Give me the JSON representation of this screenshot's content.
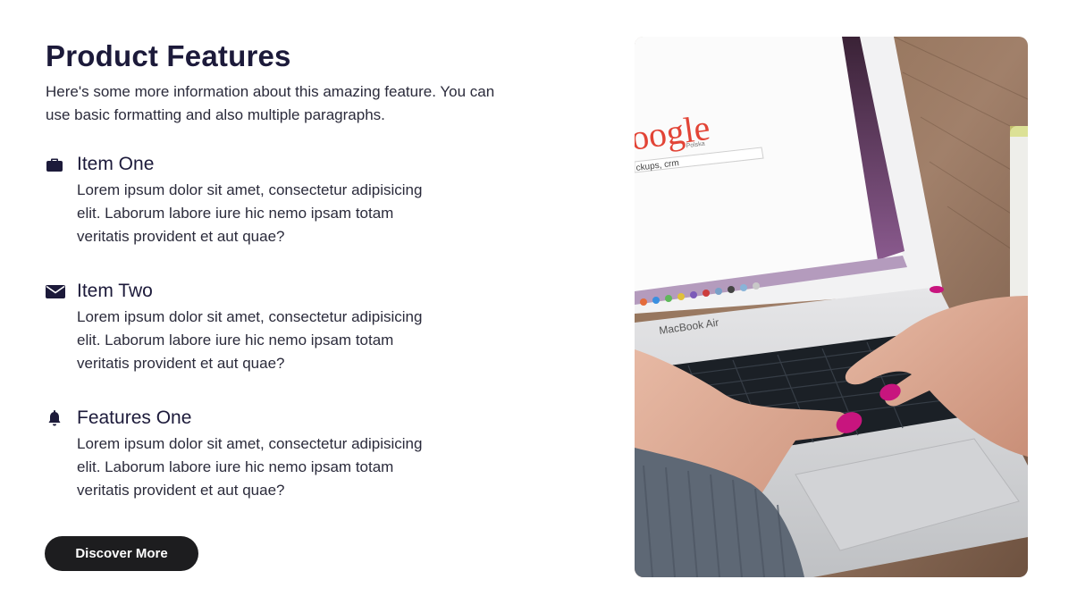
{
  "section": {
    "title": "Product Features",
    "intro": "Here's some more information about this amazing feature. You can use basic formatting and also multiple paragraphs."
  },
  "features": [
    {
      "icon": "briefcase-icon",
      "title": "Item One",
      "description": "Lorem ipsum dolor sit amet, consectetur adipisicing elit. Laborum labore iure hic nemo ipsam totam veritatis provident et aut quae?"
    },
    {
      "icon": "envelope-icon",
      "title": "Item Two",
      "description": "Lorem ipsum dolor sit amet, consectetur adipisicing elit. Laborum labore iure hic nemo ipsam totam veritatis provident et aut quae?"
    },
    {
      "icon": "bell-icon",
      "title": "Features One",
      "description": "Lorem ipsum dolor sit amet, consectetur adipisicing elit. Laborum labore iure hic nemo ipsam totam veritatis provident et aut quae?"
    }
  ],
  "cta": {
    "label": "Discover More"
  },
  "photo": {
    "screen_brand": "oogle",
    "screen_brand_sub": "Polska",
    "search_text": "ckups, crm",
    "device_label": "MacBook Air"
  },
  "colors": {
    "heading": "#1c1a3a",
    "button_bg": "#1d1d1f",
    "nail_polish": "#c8157e"
  }
}
